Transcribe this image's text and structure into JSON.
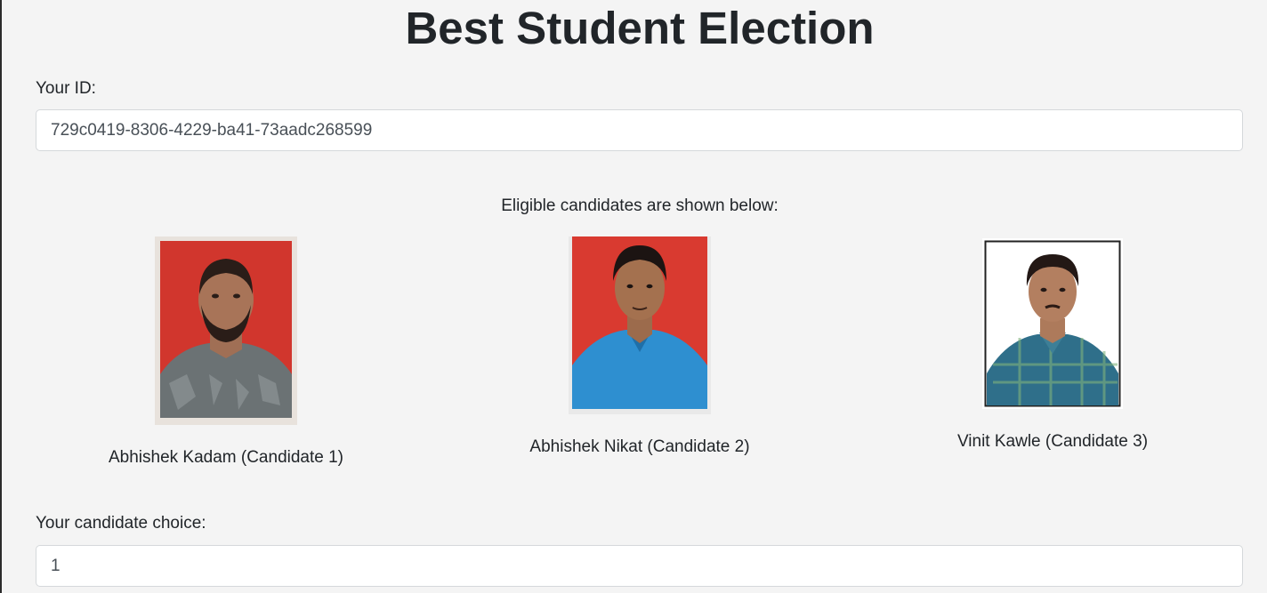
{
  "page": {
    "title": "Best Student Election"
  },
  "voter": {
    "id_label": "Your ID:",
    "id_value": "729c0419-8306-4229-ba41-73aadc268599"
  },
  "candidates_intro": "Eligible candidates are shown below:",
  "candidates": [
    {
      "name": "Abhishek Kadam (Candidate 1)",
      "photo_bg": "#d1362d"
    },
    {
      "name": "Abhishek Nikat (Candidate 2)",
      "photo_bg": "#d93a30"
    },
    {
      "name": "Vinit Kawle (Candidate 3)",
      "photo_bg": "#ffffff"
    }
  ],
  "choice": {
    "label": "Your candidate choice:",
    "value": "1"
  }
}
